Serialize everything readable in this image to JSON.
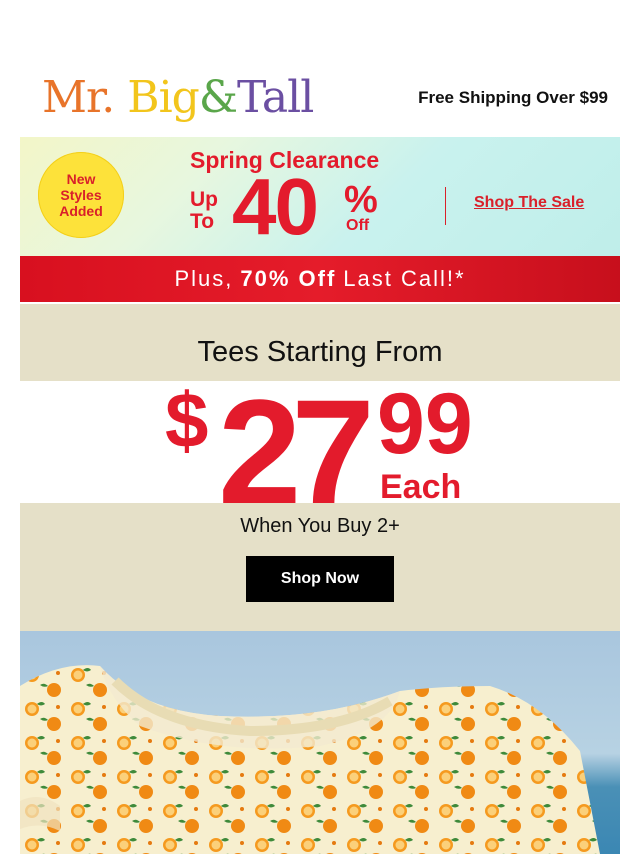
{
  "header": {
    "logo": {
      "mr": "Mr.",
      "big": "Big",
      "amp": "&",
      "tall": "Tall"
    },
    "free_shipping": "Free Shipping Over $99"
  },
  "promo": {
    "badge": [
      "New",
      "Styles",
      "Added"
    ],
    "title": "Spring Clearance",
    "up": "Up",
    "to": "To",
    "amount": "40",
    "percent": "%",
    "off": "Off",
    "cta": "Shop The Sale"
  },
  "last_call": {
    "prefix": "Plus,",
    "highlight": "70% Off",
    "suffix": "Last Call!*"
  },
  "tees": {
    "title": "Tees Starting From",
    "dollar_sign": "$",
    "whole": "27",
    "cents": "99",
    "each": "Each",
    "condition": "When You Buy 2+",
    "cta": "Shop Now"
  },
  "colors": {
    "brand_red": "#e31b2c",
    "band_beige": "#e5e0c8",
    "button_black": "#000000"
  },
  "hero": {
    "description_icon": "orange-print-tee-image"
  }
}
